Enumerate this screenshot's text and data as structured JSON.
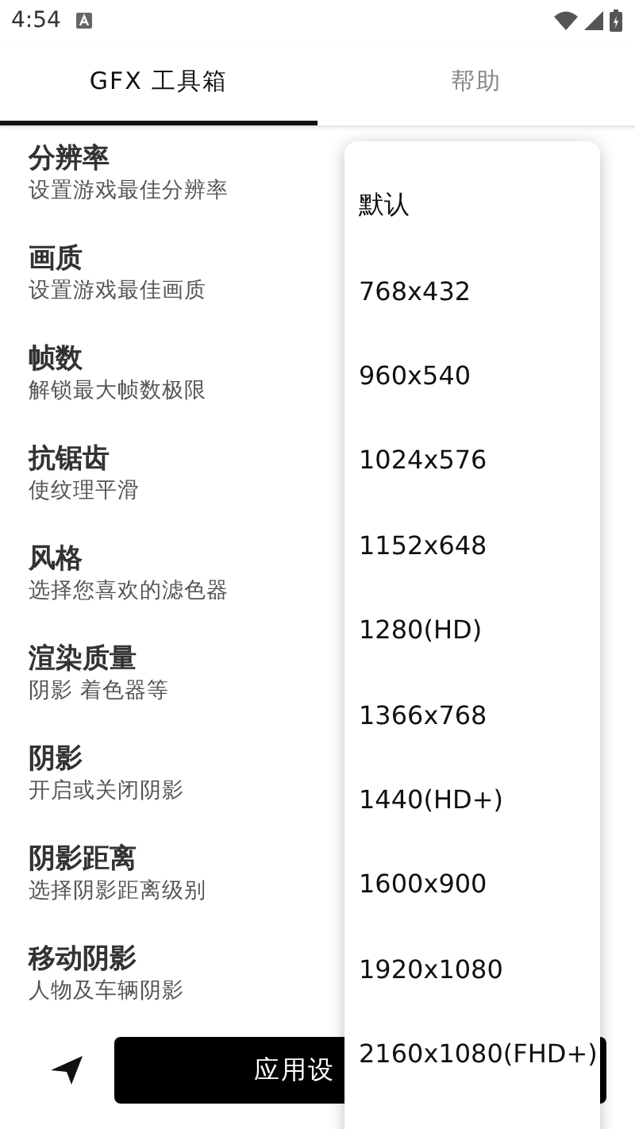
{
  "status_bar": {
    "time": "4:54"
  },
  "tabs": [
    {
      "label": "GFX 工具箱",
      "selected": true
    },
    {
      "label": "帮助",
      "selected": false
    }
  ],
  "settings": [
    {
      "title": "分辨率",
      "subtitle": "设置游戏最佳分辨率"
    },
    {
      "title": "画质",
      "subtitle": "设置游戏最佳画质"
    },
    {
      "title": "帧数",
      "subtitle": "解锁最大帧数极限"
    },
    {
      "title": "抗锯齿",
      "subtitle": "使纹理平滑"
    },
    {
      "title": "风格",
      "subtitle": "选择您喜欢的滤色器"
    },
    {
      "title": "渲染质量",
      "subtitle": "阴影 着色器等"
    },
    {
      "title": "阴影",
      "subtitle": "开启或关闭阴影"
    },
    {
      "title": "阴影距离",
      "subtitle": "选择阴影距离级别"
    },
    {
      "title": "移动阴影",
      "subtitle": "人物及车辆阴影"
    }
  ],
  "apply_button": {
    "label": "应用设"
  },
  "dropdown_menu": {
    "options": [
      "默认",
      "768x432",
      "960x540",
      "1024x576",
      "1152x648",
      "1280(HD)",
      "1366x768",
      "1440(HD+)",
      "1600x900",
      "1920x1080",
      "2160x1080(FHD+)"
    ]
  }
}
